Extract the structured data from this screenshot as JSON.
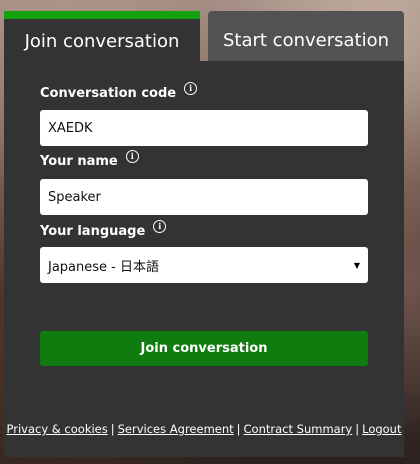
{
  "tabs": {
    "join_label": "Join conversation",
    "start_label": "Start conversation",
    "active_color": "#13a10e"
  },
  "form": {
    "code_label": "Conversation code",
    "code_value": "XAEDK",
    "name_label": "Your name",
    "name_value": "Speaker",
    "language_label": "Your language",
    "language_value": "Japanese - 日本語",
    "info_icon_glyph": "i",
    "caret_glyph": "▼",
    "submit_label": "Join conversation",
    "submit_color": "#107c10"
  },
  "footer": {
    "links": [
      "Privacy & cookies",
      "Services Agreement",
      "Contract Summary",
      "Logout"
    ],
    "separator": "|"
  },
  "icons": {
    "info": "info-icon",
    "dropdown": "chevron-down-icon"
  }
}
